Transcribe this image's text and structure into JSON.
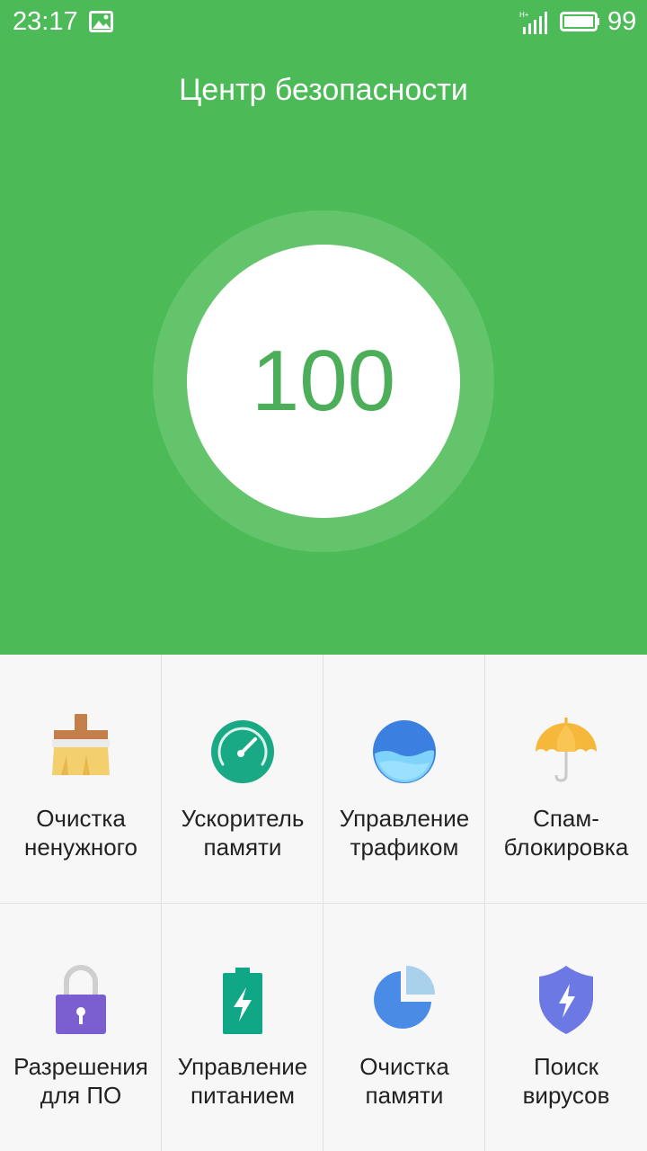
{
  "status_bar": {
    "time": "23:17",
    "battery_level": "99",
    "network_label": "H+"
  },
  "header": {
    "title": "Центр безопасности",
    "score": "100",
    "background_color": "#4cba57",
    "ring_color": "#63c46c",
    "score_color": "#4cae58"
  },
  "tools": [
    {
      "line1": "Очистка",
      "line2": "ненужного",
      "icon": "broom-icon"
    },
    {
      "line1": "Ускоритель",
      "line2": "памяти",
      "icon": "speedometer-icon"
    },
    {
      "line1": "Управление",
      "line2": "трафиком",
      "icon": "water-globe-icon"
    },
    {
      "line1": "Спам-",
      "line2": "блокировка",
      "icon": "umbrella-icon"
    },
    {
      "line1": "Разрешения",
      "line2": "для ПО",
      "icon": "lock-icon"
    },
    {
      "line1": "Управление",
      "line2": "питанием",
      "icon": "battery-charging-icon"
    },
    {
      "line1": "Очистка",
      "line2": "памяти",
      "icon": "pie-chart-icon"
    },
    {
      "line1": "Поиск",
      "line2": "вирусов",
      "icon": "shield-icon"
    }
  ]
}
